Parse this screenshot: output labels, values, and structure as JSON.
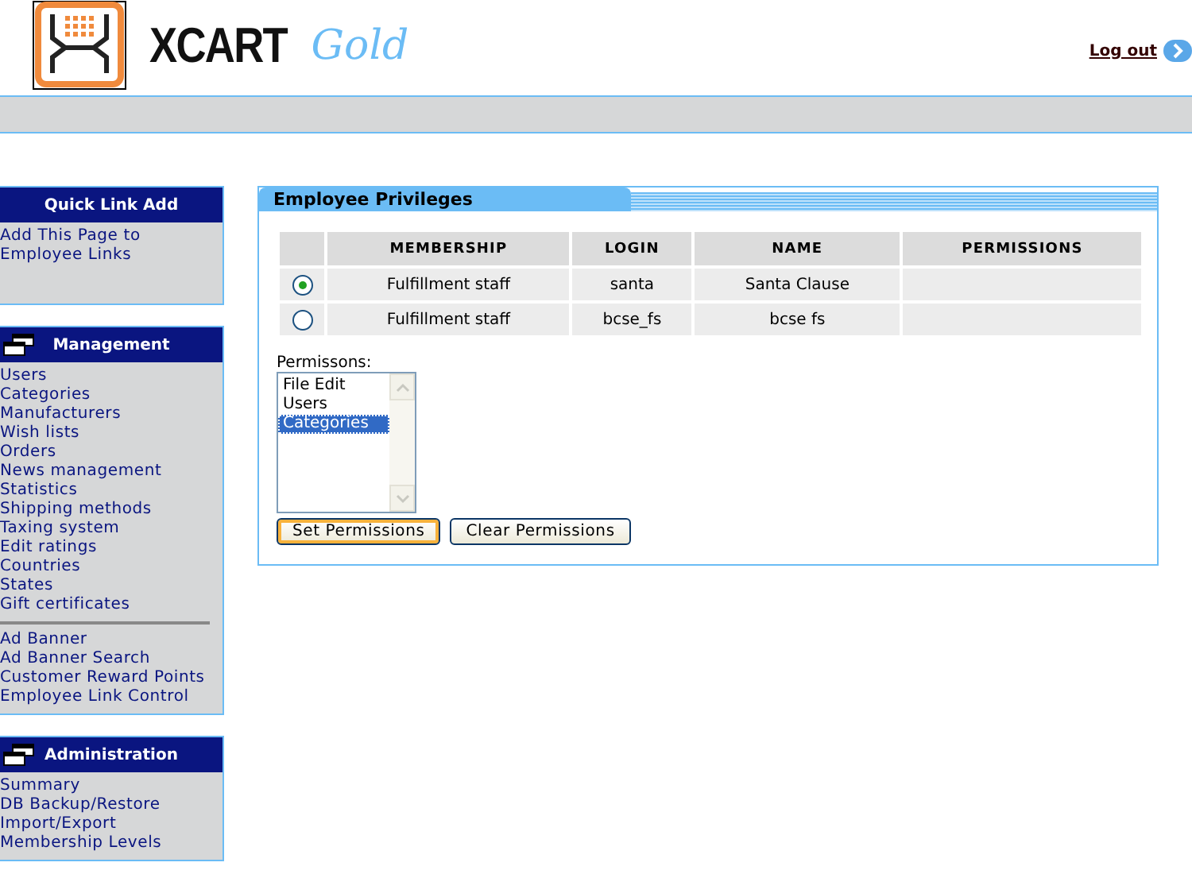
{
  "header": {
    "logo_text": "XCART",
    "logo_edition": "Gold",
    "logout": "Log out"
  },
  "sidebar": [
    {
      "kind": "plain",
      "title": "Quick Link Add",
      "groups": [
        [
          "Add This Page to Employee Links"
        ]
      ]
    },
    {
      "kind": "menu",
      "title": "Management",
      "groups": [
        [
          "Users",
          "Categories",
          "Manufacturers",
          "Wish lists",
          "Orders",
          "News management",
          "Statistics",
          "Shipping methods",
          "Taxing system",
          "Edit ratings",
          "Countries",
          "States",
          "Gift certificates"
        ],
        [
          "Ad Banner",
          "Ad Banner Search",
          "Customer Reward Points",
          "Employee Link Control"
        ]
      ]
    },
    {
      "kind": "menu",
      "title": "Administration",
      "groups": [
        [
          "Summary",
          "DB Backup/Restore",
          "Import/Export",
          "Membership Levels"
        ]
      ]
    }
  ],
  "panel": {
    "title": "Employee Privileges",
    "table": {
      "columns": [
        "MEMBERSHIP",
        "LOGIN",
        "NAME",
        "PERMISSIONS"
      ],
      "rows": [
        {
          "selected": true,
          "cells": [
            "Fulfillment staff",
            "santa",
            "Santa Clause",
            ""
          ]
        },
        {
          "selected": false,
          "cells": [
            "Fulfillment staff",
            "bcse_fs",
            "bcse fs",
            ""
          ]
        }
      ]
    },
    "permissions_label": "Permissons:",
    "permissions": [
      {
        "label": "File Edit",
        "selected": false
      },
      {
        "label": "Users",
        "selected": false
      },
      {
        "label": "Categories",
        "selected": true
      }
    ],
    "buttons": [
      {
        "label": "Set Permissions",
        "focused": true
      },
      {
        "label": "Clear Permissions",
        "focused": false
      }
    ]
  }
}
